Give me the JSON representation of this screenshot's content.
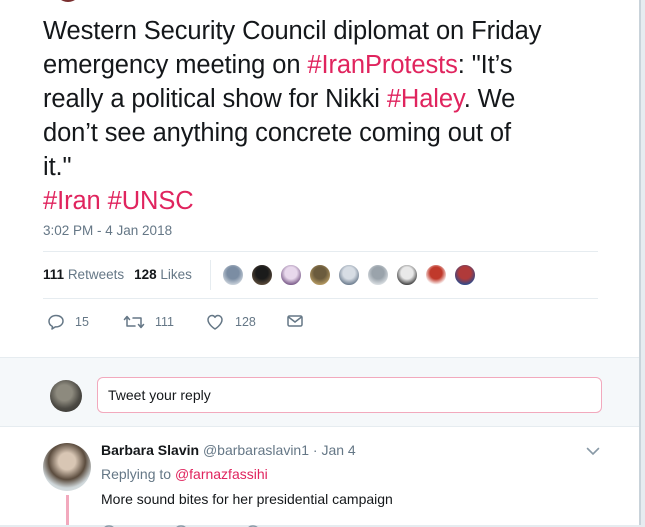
{
  "tweet": {
    "text_lines": [
      [
        {
          "t": "Western Security Council diplomat on Friday"
        }
      ],
      [
        {
          "t": "emergency meeting on "
        },
        {
          "t": "#IranProtests",
          "tag": true
        },
        {
          "t": ": \"It’s"
        }
      ],
      [
        {
          "t": "really a political show for Nikki "
        },
        {
          "t": "#Haley",
          "tag": true
        },
        {
          "t": ". We"
        }
      ],
      [
        {
          "t": "don’t see anything concrete coming out of"
        }
      ],
      [
        {
          "t": "it.\""
        }
      ],
      [
        {
          "t": "#Iran",
          "tag": true
        },
        {
          "t": " "
        },
        {
          "t": "#UNSC",
          "tag": true
        }
      ]
    ],
    "timestamp": "3:02 PM - 4 Jan 2018",
    "retweets_count": "111",
    "retweets_label": "Retweets",
    "likes_count": "128",
    "likes_label": "Likes"
  },
  "faces": [
    {
      "name": "liker-avatar-1",
      "colors": [
        "#7b8da3",
        "#c9d1da"
      ]
    },
    {
      "name": "liker-avatar-2",
      "colors": [
        "#1b1b1b",
        "#5a4a3a"
      ]
    },
    {
      "name": "liker-avatar-3",
      "colors": [
        "#e8d8ec",
        "#7b5c8a"
      ]
    },
    {
      "name": "liker-avatar-4",
      "colors": [
        "#6b5b3d",
        "#b59a62"
      ]
    },
    {
      "name": "liker-avatar-5",
      "colors": [
        "#d7dde4",
        "#6d7d8f"
      ]
    },
    {
      "name": "liker-avatar-6",
      "colors": [
        "#9aa3ab",
        "#d9dee2"
      ]
    },
    {
      "name": "liker-avatar-7",
      "colors": [
        "#e9e9e9",
        "#444444"
      ]
    },
    {
      "name": "liker-avatar-8",
      "colors": [
        "#c0392b",
        "#ffffff"
      ]
    },
    {
      "name": "liker-avatar-9",
      "colors": [
        "#b03a3a",
        "#2f4a8a"
      ]
    }
  ],
  "actions": {
    "reply_count": "15",
    "retweet_count": "111",
    "like_count": "128"
  },
  "reply_box": {
    "placeholder": "Tweet your reply"
  },
  "reply_tweet": {
    "name": "Barbara Slavin",
    "handle": "@barbaraslavin1",
    "date": "· Jan 4",
    "replying_prefix": "Replying to",
    "replying_to": "@farnazfassihi",
    "body": "More sound bites for her presidential campaign"
  },
  "colors": {
    "accent": "#e0245e",
    "muted": "#657786",
    "text": "#14171a"
  }
}
